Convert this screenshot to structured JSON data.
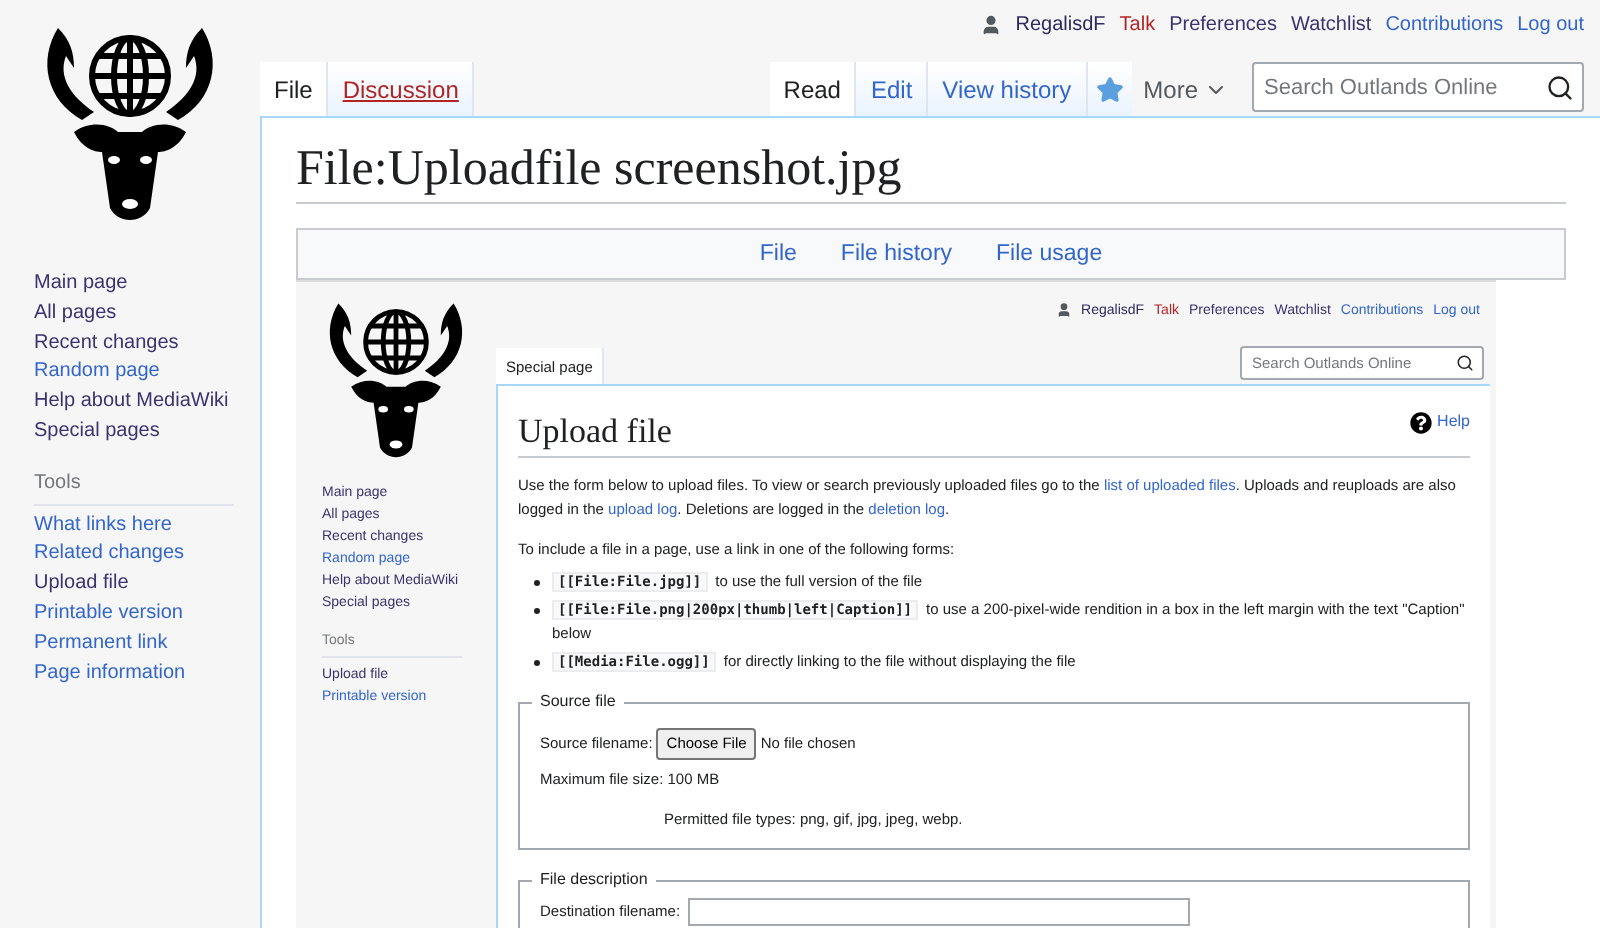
{
  "personal_tools": [
    {
      "label": "RegalisdF",
      "kind": "user"
    },
    {
      "label": "Talk",
      "kind": "missing"
    },
    {
      "label": "Preferences",
      "kind": "visited"
    },
    {
      "label": "Watchlist",
      "kind": "visited"
    },
    {
      "label": "Contributions",
      "kind": "link"
    },
    {
      "label": "Log out",
      "kind": "link"
    }
  ],
  "namespace_tabs": [
    {
      "label": "File",
      "selected": true,
      "missing": false
    },
    {
      "label": "Discussion",
      "selected": false,
      "missing": true
    }
  ],
  "view_tabs": [
    {
      "label": "Read",
      "selected": true
    },
    {
      "label": "Edit",
      "selected": false
    },
    {
      "label": "View history",
      "selected": false
    }
  ],
  "more_menu": {
    "label": "More"
  },
  "search": {
    "placeholder": "Search Outlands Online"
  },
  "sidebar": {
    "navigation": [
      {
        "label": "Main page",
        "visited": true
      },
      {
        "label": "All pages",
        "visited": true
      },
      {
        "label": "Recent changes",
        "visited": true
      },
      {
        "label": "Random page",
        "visited": false
      },
      {
        "label": "Help about MediaWiki",
        "visited": true
      },
      {
        "label": "Special pages",
        "visited": true
      }
    ],
    "tools_heading": "Tools",
    "tools": [
      {
        "label": "What links here",
        "visited": false
      },
      {
        "label": "Related changes",
        "visited": false
      },
      {
        "label": "Upload file",
        "visited": true
      },
      {
        "label": "Printable version",
        "visited": false
      },
      {
        "label": "Permanent link",
        "visited": false
      },
      {
        "label": "Page information",
        "visited": false
      }
    ]
  },
  "title": "File:Uploadfile screenshot.jpg",
  "file_tabs": [
    "File",
    "File history",
    "File usage"
  ],
  "embedded_screenshot": {
    "personal_tools": [
      {
        "label": "RegalisdF",
        "kind": "user"
      },
      {
        "label": "Talk",
        "kind": "missing"
      },
      {
        "label": "Preferences",
        "kind": "visited"
      },
      {
        "label": "Watchlist",
        "kind": "visited"
      },
      {
        "label": "Contributions",
        "kind": "link"
      },
      {
        "label": "Log out",
        "kind": "link"
      }
    ],
    "tab": "Special page",
    "search": {
      "placeholder": "Search Outlands Online"
    },
    "sidebar": {
      "navigation": [
        {
          "label": "Main page",
          "visited": true
        },
        {
          "label": "All pages",
          "visited": true
        },
        {
          "label": "Recent changes",
          "visited": true
        },
        {
          "label": "Random page",
          "visited": false
        },
        {
          "label": "Help about MediaWiki",
          "visited": true
        },
        {
          "label": "Special pages",
          "visited": true
        }
      ],
      "tools_heading": "Tools",
      "tools": [
        {
          "label": "Upload file",
          "visited": true
        },
        {
          "label": "Printable version",
          "visited": false
        }
      ]
    },
    "title": "Upload file",
    "help": "Help",
    "paragraphs": [
      [
        {
          "text": "Use the form below to upload files. To view or search previously uploaded files go to the "
        },
        {
          "text": "list of uploaded files",
          "link": true
        },
        {
          "text": ". Uploads and reuploads are also logged in the "
        },
        {
          "text": "upload log",
          "link": true
        },
        {
          "text": ". Deletions are logged in the "
        },
        {
          "text": "deletion log",
          "link": true
        },
        {
          "text": "."
        }
      ],
      [
        {
          "text": "To include a file in a page, use a link in one of the following forms:"
        }
      ]
    ],
    "forms": [
      {
        "code": "[[File:File.jpg]]",
        "text": "to use the full version of the file"
      },
      {
        "code": "[[File:File.png|200px|thumb|left|Caption]]",
        "text": "to use a 200-pixel-wide rendition in a box in the left margin with the text \"Caption\" below"
      },
      {
        "code": "[[Media:File.ogg]]",
        "text": "for directly linking to the file without displaying the file"
      }
    ],
    "source_file": {
      "legend": "Source file",
      "filename_label": "Source filename:",
      "choose_button": "Choose File",
      "no_file": "No file chosen",
      "max_size": "Maximum file size: 100 MB",
      "permitted": "Permitted file types: png, gif, jpg, jpeg, webp."
    },
    "file_description": {
      "legend": "File description",
      "destination_label": "Destination filename:"
    }
  }
}
